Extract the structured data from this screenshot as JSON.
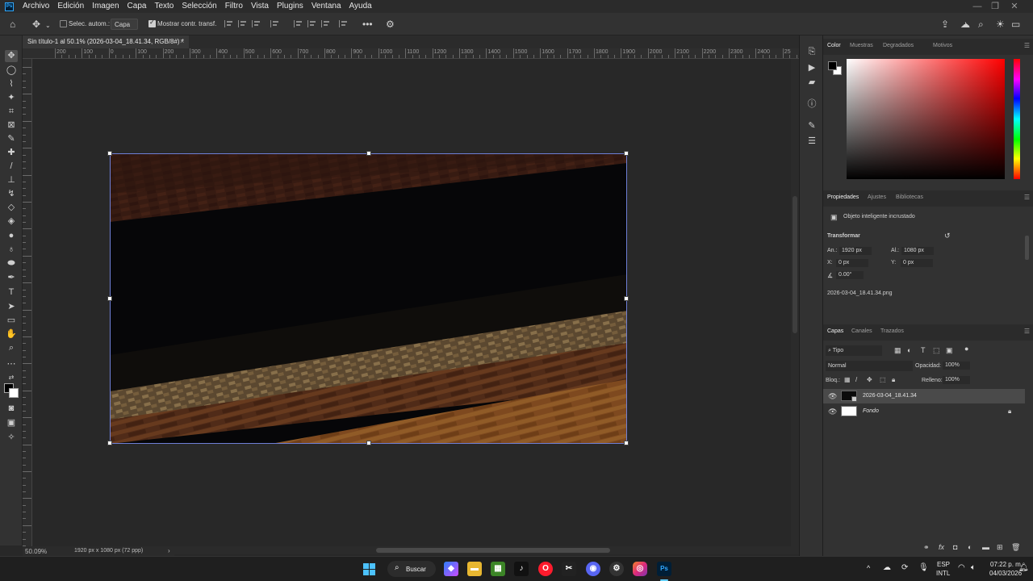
{
  "app": {
    "logo_text": "Ps"
  },
  "menu": [
    "Archivo",
    "Edición",
    "Imagen",
    "Capa",
    "Texto",
    "Selección",
    "Filtro",
    "Vista",
    "Plugins",
    "Ventana",
    "Ayuda"
  ],
  "window_controls": {
    "minimize": "—",
    "maximize": "❐",
    "close": "✕"
  },
  "options_bar": {
    "auto_select_label": "Selec. autom.:",
    "auto_select_target": "Capa",
    "show_transform_label": "Mostrar contr. transf.",
    "more": "•••"
  },
  "document_tab": {
    "title": "Sin título-1 al 50.1% (2026-03-04_18.41.34, RGB/8#) *",
    "close": "×"
  },
  "ruler_top_labels": [
    "200",
    "100",
    "0",
    "100",
    "200",
    "300",
    "400",
    "500",
    "600",
    "700",
    "800",
    "900",
    "1000",
    "1100",
    "1200",
    "1300",
    "1400",
    "1500",
    "1600",
    "1700",
    "1800",
    "1900",
    "2000",
    "2100",
    "2200",
    "2300",
    "2400",
    "25"
  ],
  "status": {
    "zoom": "50.09%",
    "doc_size": "1920 px x 1080 px (72 ppp)"
  },
  "color_panel": {
    "tabs": [
      "Color",
      "Muestras",
      "Degradados",
      "Motivos"
    ],
    "foreground": "#000000",
    "background": "#ffffff"
  },
  "properties_panel": {
    "tabs": [
      "Propiedades",
      "Ajustes",
      "Bibliotecas"
    ],
    "object_type": "Objeto inteligente incrustado",
    "transform_header": "Transformar",
    "width_label": "An.:",
    "width_value": "1920 px",
    "height_label": "Al.:",
    "height_value": "1080 px",
    "x_label": "X:",
    "x_value": "0 px",
    "y_label": "Y:",
    "y_value": "0 px",
    "angle_value": "0.00°",
    "source_file": "2026-03-04_18.41.34.png"
  },
  "layers_panel": {
    "tabs": [
      "Capas",
      "Canales",
      "Trazados"
    ],
    "filter_kind": "Tipo",
    "blend_mode": "Normal",
    "opacity_label": "Opacidad:",
    "opacity_value": "100%",
    "lock_label": "Bloq.:",
    "fill_label": "Relleno:",
    "fill_value": "100%",
    "layers": [
      {
        "name": "2026-03-04_18.41.34"
      },
      {
        "name": "Fondo"
      }
    ],
    "footer_icons": [
      "link-icon",
      "fx-icon",
      "mask-icon",
      "adjustment-icon",
      "group-icon",
      "new-layer-icon",
      "trash-icon"
    ]
  },
  "taskbar": {
    "search_label": "Buscar",
    "lang_top": "ESP",
    "lang_bottom": "INTL",
    "time": "07:22 p. m.",
    "date": "04/03/2026",
    "ps_label": "Ps"
  }
}
